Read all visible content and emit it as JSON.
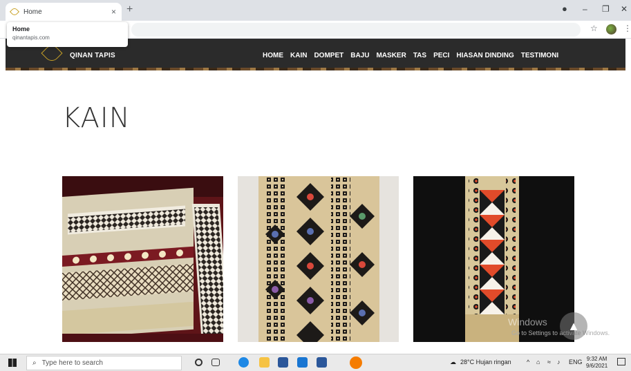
{
  "browser": {
    "tab_title": "Home",
    "tab_close": "×",
    "new_tab": "+",
    "hover_title": "Home",
    "hover_url": "qinantapis.com",
    "win_minimize": "–",
    "win_restore": "❐",
    "win_close": "✕",
    "star": "☆",
    "menu": "⋮"
  },
  "site": {
    "brand": "QINAN TAPIS",
    "nav": [
      "HOME",
      "KAIN",
      "DOMPET",
      "BAJU",
      "MASKER",
      "TAS",
      "PECI",
      "HIASAN DINDING",
      "TESTIMONI"
    ]
  },
  "page": {
    "title": "KAIN",
    "watermark_line1": "Windows",
    "watermark_line2": "Go to Settings to activate Windows."
  },
  "taskbar": {
    "search_placeholder": "Type here to search",
    "weather": "28°C  Hujan ringan",
    "lang": "ENG",
    "time": "9:32 AM",
    "date": "9/6/2021"
  },
  "colors": {
    "nav_bg": "#2b2b2b",
    "accent_gold": "#c9a227"
  }
}
